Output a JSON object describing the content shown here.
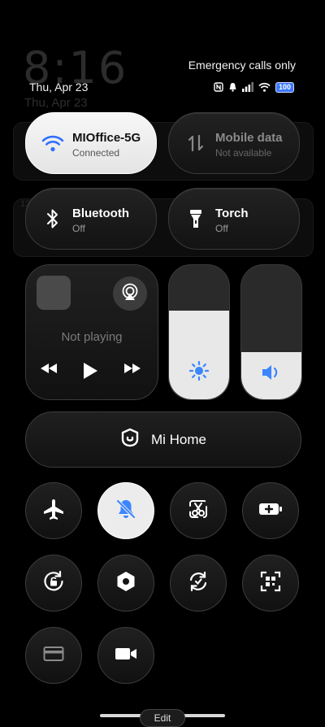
{
  "background": {
    "time": "8:16",
    "date": "Thu, Apr 23",
    "card_label": "12:27 PM"
  },
  "header": {
    "date": "Thu, Apr 23",
    "carrier_status": "Emergency calls only",
    "battery_level": "100",
    "status_icons": [
      "nfc-icon",
      "notification-icon",
      "signal-icon",
      "wifi-icon",
      "battery-icon"
    ]
  },
  "tiles": {
    "wifi": {
      "title": "MIOffice-5G",
      "subtitle": "Connected",
      "icon": "wifi-icon",
      "active": true
    },
    "mobile_data": {
      "title": "Mobile data",
      "subtitle": "Not available",
      "icon": "mobile-data-icon",
      "active": false
    },
    "bluetooth": {
      "title": "Bluetooth",
      "subtitle": "Off",
      "icon": "bluetooth-icon",
      "active": false
    },
    "torch": {
      "title": "Torch",
      "subtitle": "Off",
      "icon": "torch-icon",
      "active": false
    }
  },
  "media": {
    "status": "Not playing",
    "controls": [
      "previous-icon",
      "play-icon",
      "next-icon"
    ]
  },
  "sliders": {
    "brightness": {
      "level_percent": 66,
      "icon": "sun-icon"
    },
    "volume": {
      "level_percent": 35,
      "icon": "speaker-icon"
    }
  },
  "mi_home": {
    "label": "Mi Home"
  },
  "toggles": [
    {
      "name": "airplane-mode",
      "icon": "airplane-icon",
      "active": false
    },
    {
      "name": "mute",
      "icon": "bell-off-icon",
      "active": true
    },
    {
      "name": "screenshot",
      "icon": "scissors-icon",
      "active": false
    },
    {
      "name": "battery-saver",
      "icon": "battery-plus-icon",
      "active": false
    },
    {
      "name": "rotation-lock",
      "icon": "rotation-lock-icon",
      "active": false
    },
    {
      "name": "settings",
      "icon": "hexagon-icon",
      "active": false
    },
    {
      "name": "auto-sync",
      "icon": "sync-icon",
      "active": false
    },
    {
      "name": "scanner",
      "icon": "qr-scan-icon",
      "active": false
    },
    {
      "name": "card",
      "icon": "card-icon",
      "active": false
    },
    {
      "name": "screen-recorder",
      "icon": "video-camera-icon",
      "active": false
    }
  ],
  "footer": {
    "edit_label": "Edit"
  },
  "colors": {
    "accent": "#3b78ff",
    "active_tile": "#ececec",
    "background": "#000000"
  }
}
